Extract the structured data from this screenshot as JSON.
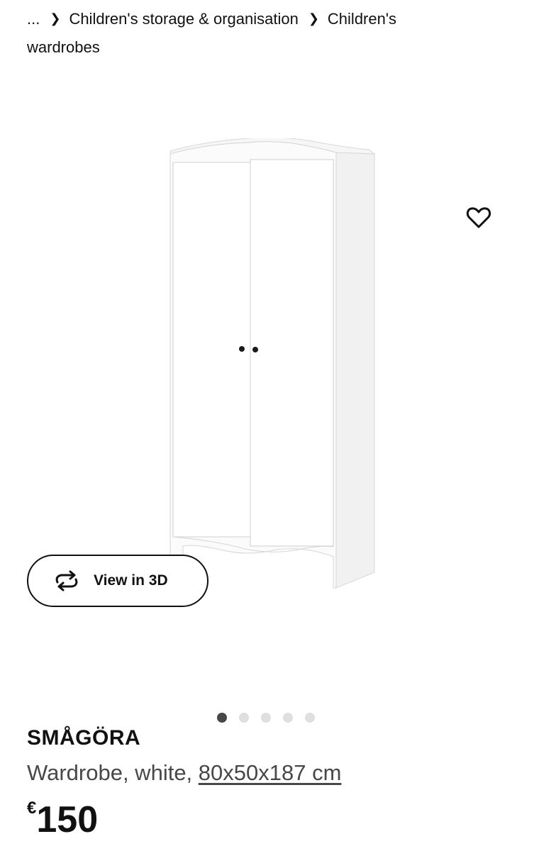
{
  "breadcrumb": {
    "ellipsis": "...",
    "items": [
      "Children's storage & organisation",
      "Children's wardrobes"
    ]
  },
  "gallery": {
    "favourite_icon": "heart-icon",
    "view_3d": {
      "label": "View in 3D",
      "icon": "rotate-arrows-icon"
    },
    "image_count": 5,
    "active_index": 0
  },
  "product": {
    "name": "SMÅGÖRA",
    "description_prefix": "Wardrobe, white, ",
    "dimensions": "80x50x187 cm",
    "currency": "€",
    "price": "150"
  },
  "colors": {
    "text": "#111111",
    "secondary_text": "#484848",
    "dot_active": "#484848",
    "dot_inactive": "#dfdfdf"
  }
}
